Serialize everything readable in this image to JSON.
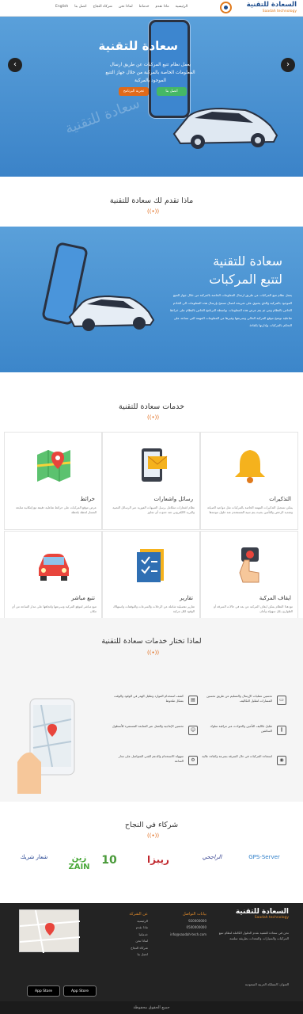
{
  "nav": {
    "brand_ar": "السعادة للتقنية",
    "brand_en": "Saadah technology",
    "menu": [
      "الرئيسية",
      "ماذا نقدم",
      "خدماتنا",
      "لماذا نحن",
      "شركاء النجاح",
      "اتصل بنا"
    ],
    "lang": "English"
  },
  "hero": {
    "title": "سعادة للتقنية",
    "subtitle": "يعمل نظام تتبع المركبات عن طريق ارسال المعلومات الخاصة بالمركبة من خلال جهاز التتبع الموجود بالمركبة",
    "btn_trial": "تجربة البرنامج",
    "btn_contact": "اتصل بنا",
    "watermark": "سعادة للتقنية",
    "prev": "‹",
    "next": "›"
  },
  "offer": {
    "title": "ماذا تقدم لك سعادة للتقنية"
  },
  "tracking": {
    "heading_line1": "سعادة للتقنية",
    "heading_line2": "لتتبع المركبات",
    "paragraph": "يعمل نظام تتبع المركبات عن طريق ارسال المعلومات الخاصة بالمركبة من خلال جهاز التتبع الموجود بالمركبة والذي يحتوي على شريحة اتصال تسمح بإرسال هذه المعلومات الى الخادم الخاص بالنظام ومن ثم يتم عرض هذه المعلومات بواسطة البرنامج الخاص بالنظام على خرائط تفاعلية توضح موقع المركبة الحالي وسرعتها وغيرها من المعلومات المهمة التي تساعد على التحكم بالمركبات وإدارتها بكفاءة"
  },
  "services": {
    "title": "خدمات سعادة للتقنية",
    "cards": [
      {
        "title": "التذكيرات",
        "desc": "يمكن تسجيل التذكيرات المهمة الخاصة بالمركبات مثل مواعيد الصيانة وتجديد الرخص والتأمين بحيث يتم تنبيه المستخدم عند حلول موعدها"
      },
      {
        "title": "رسائل واشعارات",
        "desc": "نظام اشعارات متكامل يرسل التنبيهات الفورية عبر الرسائل النصية والبريد الالكتروني عند حدوث أي تجاوز"
      },
      {
        "title": "خرائط",
        "desc": "عرض موقع المركبات على خرائط تفاعلية دقيقة مع إمكانية متابعة المسار لحظة بلحظة"
      },
      {
        "title": "ايقاف المركبة",
        "desc": "مع هذا النظام يمكن ايقاف المركبة عن بعد في حالات السرقة أو الطوارئ بكل سهولة وأمان"
      },
      {
        "title": "تقارير",
        "desc": "تقارير تفصيلية شاملة عن الرحلات والسرعات والتوقفات واستهلاك الوقود لكل مركبة"
      },
      {
        "title": "تتبع مباشر",
        "desc": "تتبع مباشر لموقع المركبة وسرعتها واتجاهها على مدار الساعة من أي مكان"
      }
    ]
  },
  "why": {
    "title": "لماذا تختار خدمات سعادة للتقنية",
    "items": [
      "تحسين عمليات الإرسال والتسليم عن طريق تحسين المسارات لتقليل التكاليف",
      "كشف استخدام الموارد وتقليل الهدر في الوقود والوقت بشكل ملحوظ",
      "تقليل تكاليف التأمين والحوادث عبر مراقبة سلوك السائقين",
      "تحسين الإنتاجية والعمل عبر المتابعة المستمرة للأسطول",
      "استعادة المركبات في حال السرقة بسرعة وكفاءة عالية",
      "سهولة الاستخدام والدعم الفني المتواصل على مدار الساعة"
    ],
    "icons": [
      "truck-icon",
      "chart-icon",
      "road-icon",
      "people-icon",
      "pin-icon",
      "gear-icon"
    ]
  },
  "partners": {
    "title": "شركاء في النجاح",
    "names": [
      "GPS-Server",
      "الراجحي",
      "ريبزا",
      "10",
      "زين ZAIN",
      "شعار شريك"
    ]
  },
  "footer": {
    "brand_ar": "السعادة للتقنية",
    "brand_en": "Saadah technology",
    "about": "نحن في سعادة للتقنية نقدم الحلول الكاملة لنظام تتبع المركبات والسيارات والمعدات بطريقة سلسة",
    "contact_title": "بيانات التواصل",
    "contact_lines": [
      "920000000",
      "0500000000",
      "info@saadah-tech.com"
    ],
    "links_title": "عن الشركة",
    "links": [
      "الرئيسية",
      "ماذا نقدم",
      "خدماتنا",
      "لماذا نحن",
      "شركاء النجاح",
      "اتصل بنا"
    ],
    "address": "العنوان: المملكة العربية السعودية",
    "store1": "App Store",
    "store2": "App Store",
    "copyright": "جميع الحقوق محفوظة"
  }
}
